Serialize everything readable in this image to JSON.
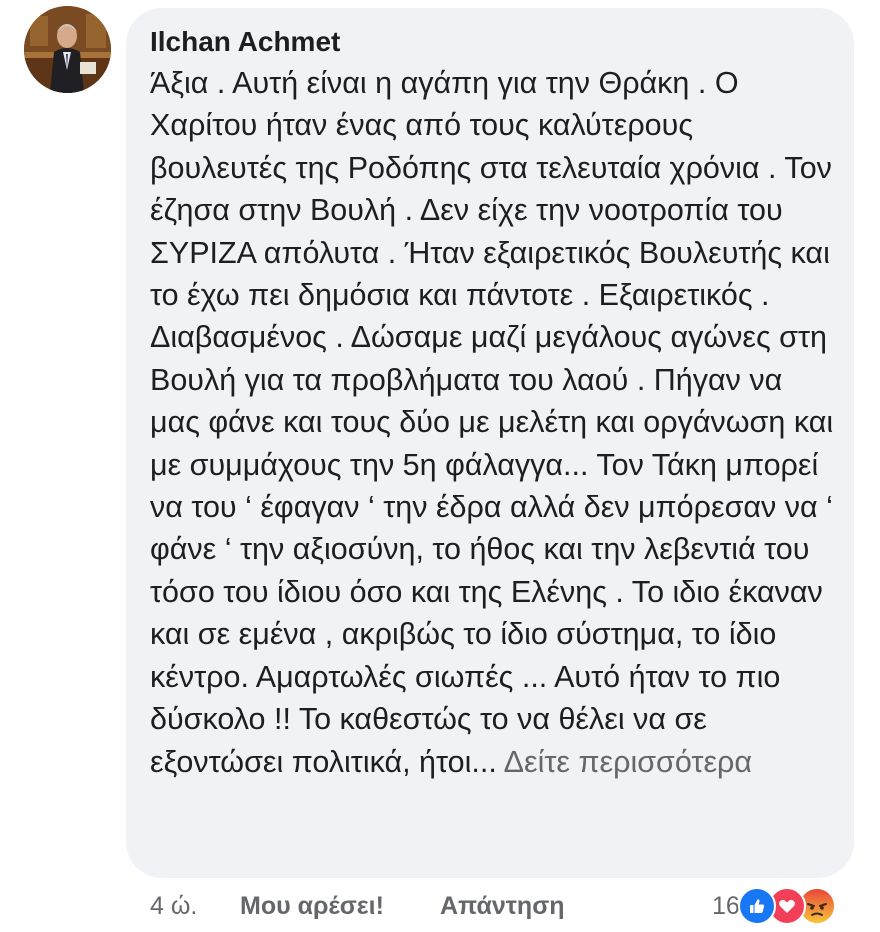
{
  "comment": {
    "author": "Ilchan Achmet",
    "text": "Άξια . Αυτή είναι  η αγάπη για την Θράκη . Ο Χαρίτου ήταν ένας από τους καλύτερους βουλευτές της Ροδόπης στα τελευταία χρόνια . Τον έζησα στην Βουλή . Δεν είχε την νοοτροπία του ΣΥΡΙΖΑ απόλυτα . Ήταν εξαιρετικός Βουλευτής και το έχω πει δημόσια και πάντοτε . Εξαιρετικός . Διαβασμένος . Δώσαμε μαζί μεγάλους αγώνες στη Βουλή  για τα προβλήματα του λαού . Πήγαν να μας φάνε και τους δύο με μελέτη και οργάνωση και με συμμάχους την 5η φάλαγγα... Τον Τάκη μπορεί να  του ‘ έφαγαν ‘ την έδρα αλλά δεν μπόρεσαν να ‘ φάνε ‘ την αξιοσύνη, το ήθος και την λεβεντιά του τόσο του ίδιου όσο και της Ελένης . Το ιδιο έκαναν και σε εμένα , ακριβώς το ίδιο σύστημα, το ίδιο κέντρο. Αμαρτωλές σιωπές ... Αυτό ήταν το πιο δύσκολο !! Το καθεστώς το να θέλει να σε εξοντώσει πολιτικά, ήτοι...",
    "see_more": "Δείτε περισσότερα"
  },
  "actions": {
    "time": "4 ώ.",
    "like_label": "Μου αρέσει!",
    "reply_label": "Απάντηση"
  },
  "reactions": {
    "count": "16",
    "types": [
      "like-icon",
      "love-icon",
      "angry-icon"
    ]
  },
  "colors": {
    "bubble": "#f0f2f5",
    "text": "#1c1e21",
    "secondary": "#65676b",
    "like": "#1877f2",
    "love": "#f33e58",
    "angry": "#f5a623"
  }
}
